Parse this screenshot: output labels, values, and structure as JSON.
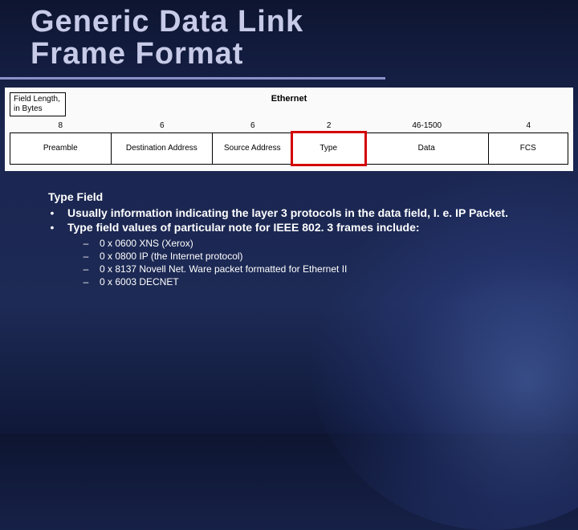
{
  "title": "Generic Data Link Frame Format",
  "diagram": {
    "cornerLabel": "Field Length, in Bytes",
    "headerLabel": "Ethernet",
    "fields": [
      {
        "bytes": "8",
        "name": "Preamble",
        "flex": 1.4
      },
      {
        "bytes": "6",
        "name": "Destination Address",
        "flex": 1.4
      },
      {
        "bytes": "6",
        "name": "Source Address",
        "flex": 1.1
      },
      {
        "bytes": "2",
        "name": "Type",
        "flex": 1.0,
        "highlight": true
      },
      {
        "bytes": "46-1500",
        "name": "Data",
        "flex": 1.7
      },
      {
        "bytes": "4",
        "name": "FCS",
        "flex": 1.1
      }
    ]
  },
  "section": {
    "heading": "Type Field",
    "bullets": [
      "Usually information indicating the layer 3 protocols in the data field, I. e. IP Packet.",
      "Type field values of particular note for IEEE 802. 3 frames include:"
    ],
    "sub": [
      "0 x 0600 XNS (Xerox)",
      "0 x 0800 IP (the Internet protocol)",
      "0 x 8137 Novell Net. Ware packet formatted for Ethernet II",
      "0 x 6003 DECNET"
    ]
  }
}
